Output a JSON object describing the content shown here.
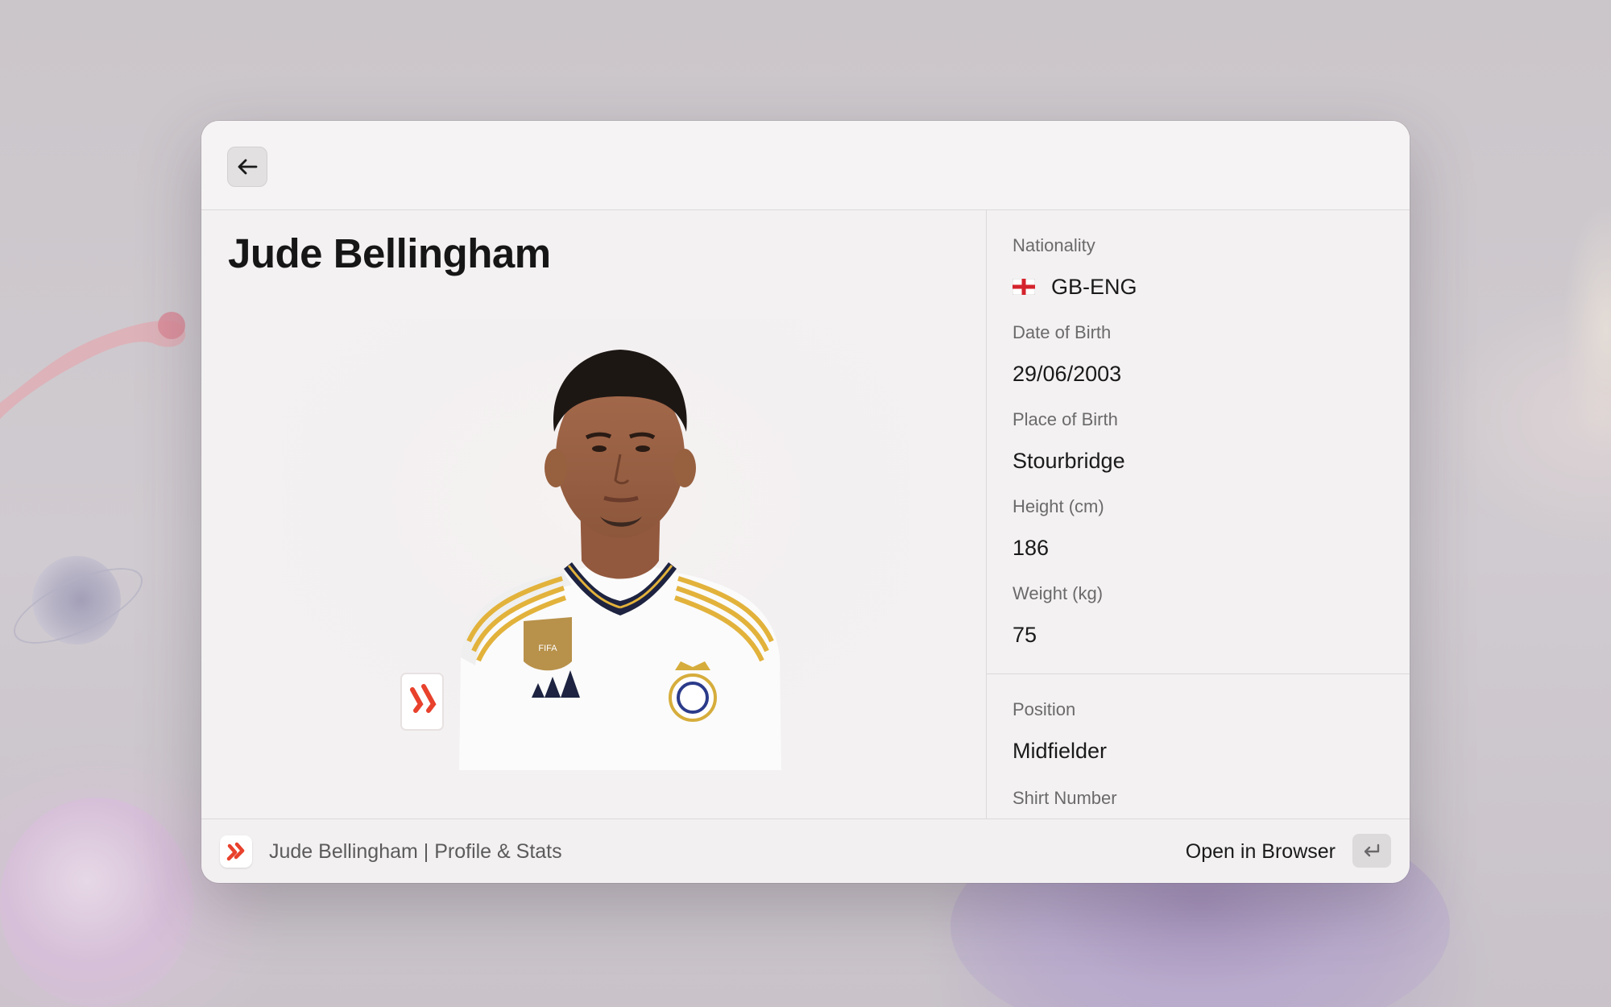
{
  "window": {
    "back_icon": "arrow-left-icon"
  },
  "profile": {
    "name": "Jude Bellingham",
    "photo_icon": "player-photo"
  },
  "details": {
    "nationality": {
      "label": "Nationality",
      "value": "GB-ENG",
      "flag_icon": "england-flag-icon"
    },
    "date_of_birth": {
      "label": "Date of Birth",
      "value": "29/06/2003"
    },
    "place_of_birth": {
      "label": "Place of Birth",
      "value": "Stourbridge"
    },
    "height": {
      "label": "Height (cm)",
      "value": "186"
    },
    "weight": {
      "label": "Weight (kg)",
      "value": "75"
    },
    "position": {
      "label": "Position",
      "value": "Midfielder"
    },
    "shirt_number": {
      "label": "Shirt Number",
      "value": ""
    }
  },
  "footer": {
    "app_icon": "laliga-icon",
    "title": "Jude Bellingham | Profile & Stats",
    "primary_action": "Open in Browser",
    "shortcut_icon": "enter-key-icon"
  },
  "colors": {
    "accent": "#e8412c",
    "jersey": "#ffffff",
    "jersey_trim": "#e5b93d",
    "collar": "#1d2340"
  }
}
